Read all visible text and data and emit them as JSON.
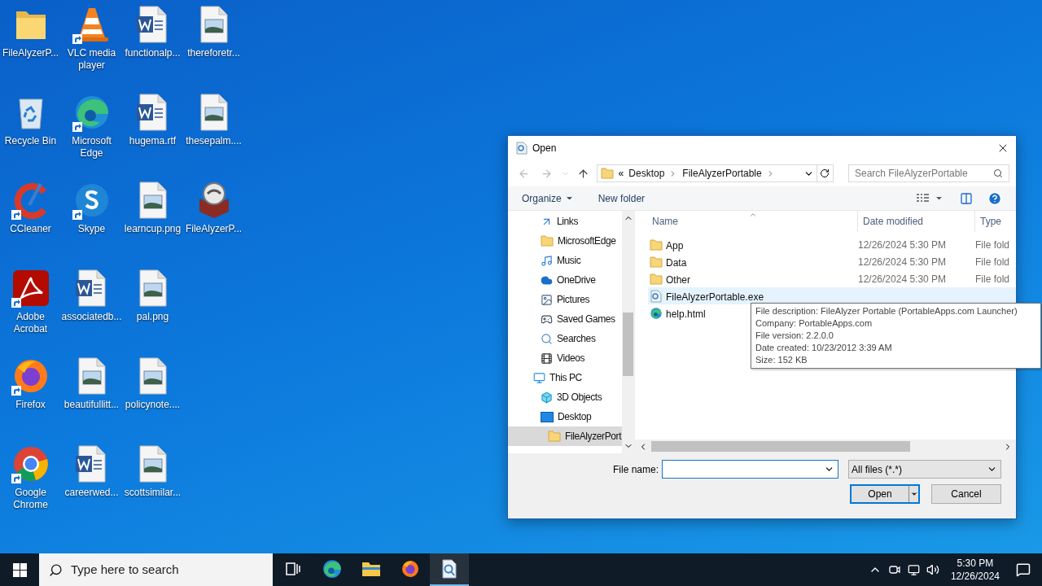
{
  "desktop_icons": [
    {
      "label": "FileAlyzerP...",
      "kind": "folder",
      "shortcut": false
    },
    {
      "label": "Recycle Bin",
      "kind": "recycle",
      "shortcut": false
    },
    {
      "label": "CCleaner",
      "kind": "ccleaner",
      "shortcut": true
    },
    {
      "label": "Adobe Acrobat",
      "kind": "acrobat",
      "shortcut": true
    },
    {
      "label": "Firefox",
      "kind": "firefox",
      "shortcut": true
    },
    {
      "label": "Google Chrome",
      "kind": "chrome",
      "shortcut": true
    },
    {
      "label": "VLC media player",
      "kind": "vlc",
      "shortcut": true
    },
    {
      "label": "Microsoft Edge",
      "kind": "edge",
      "shortcut": true
    },
    {
      "label": "Skype",
      "kind": "skype",
      "shortcut": true
    },
    {
      "label": "associatedb...",
      "kind": "word",
      "shortcut": false
    },
    {
      "label": "beautifullitt...",
      "kind": "image",
      "shortcut": false
    },
    {
      "label": "careerwed...",
      "kind": "word",
      "shortcut": false
    },
    {
      "label": "functionalp...",
      "kind": "word",
      "shortcut": false
    },
    {
      "label": "hugema.rtf",
      "kind": "word",
      "shortcut": false
    },
    {
      "label": "learncup.png",
      "kind": "image",
      "shortcut": false
    },
    {
      "label": "pal.png",
      "kind": "image",
      "shortcut": false
    },
    {
      "label": "policynote....",
      "kind": "image",
      "shortcut": false
    },
    {
      "label": "scottsimilar...",
      "kind": "image",
      "shortcut": false
    },
    {
      "label": "thereforetr...",
      "kind": "image",
      "shortcut": false
    },
    {
      "label": "thesepalm....",
      "kind": "image",
      "shortcut": false
    },
    {
      "label": "FileAlyzerP...",
      "kind": "appbox",
      "shortcut": false
    }
  ],
  "dialog": {
    "title": "Open",
    "address": {
      "overflow": "«",
      "path": [
        "Desktop",
        "FileAlyzerPortable"
      ]
    },
    "search": {
      "placeholder": "Search FileAlyzerPortable"
    },
    "toolbar": {
      "organize": "Organize",
      "new_folder": "New folder"
    },
    "tree": {
      "scrolled_items": [
        {
          "label": "Links",
          "kind": "links",
          "selected": false
        },
        {
          "label": "MicrosoftEdge",
          "kind": "folder",
          "selected": false
        },
        {
          "label": "Music",
          "kind": "music",
          "selected": false
        },
        {
          "label": "OneDrive",
          "kind": "cloud",
          "selected": false
        },
        {
          "label": "Pictures",
          "kind": "pictures",
          "selected": false
        },
        {
          "label": "Saved Games",
          "kind": "games",
          "selected": false
        },
        {
          "label": "Searches",
          "kind": "search",
          "selected": false
        },
        {
          "label": "Videos",
          "kind": "videos",
          "selected": false
        }
      ],
      "roots": [
        {
          "label": "This PC",
          "kind": "pc",
          "selected": false,
          "children": [
            {
              "label": "3D Objects",
              "kind": "cube",
              "selected": false
            },
            {
              "label": "Desktop",
              "kind": "desktop",
              "selected": false,
              "children": [
                {
                  "label": "FileAlyzerPort",
                  "kind": "folder",
                  "selected": true
                }
              ]
            }
          ]
        }
      ]
    },
    "columns": [
      "Name",
      "Date modified",
      "Type"
    ],
    "files": [
      {
        "name": "App",
        "kind": "folder",
        "date": "12/26/2024 5:30 PM",
        "type": "File fold",
        "hovered": false
      },
      {
        "name": "Data",
        "kind": "folder",
        "date": "12/26/2024 5:30 PM",
        "type": "File fold",
        "hovered": false
      },
      {
        "name": "Other",
        "kind": "folder",
        "date": "12/26/2024 5:30 PM",
        "type": "File fold",
        "hovered": false
      },
      {
        "name": "FileAlyzerPortable.exe",
        "kind": "exe",
        "hovered": true
      },
      {
        "name": "help.html",
        "kind": "edge",
        "hovered": false
      }
    ],
    "tooltip": [
      "File description: FileAlyzer Portable (PortableApps.com Launcher)",
      "Company: PortableApps.com",
      "File version: 2.2.0.0",
      "Date created: 10/23/2012 3:39 AM",
      "Size: 152 KB"
    ],
    "file_name": {
      "label": "File name:"
    },
    "filter": "All files (*.*)",
    "buttons": [
      {
        "label": "Open",
        "kind": "split"
      },
      {
        "label": "Cancel",
        "kind": "plain"
      }
    ]
  },
  "taskbar": {
    "search": {
      "placeholder": "Type here to search"
    },
    "apps": [
      {
        "kind": "taskview",
        "active": false
      },
      {
        "kind": "edge",
        "active": false
      },
      {
        "kind": "explorer",
        "active": false
      },
      {
        "kind": "firefox",
        "active": false
      },
      {
        "kind": "viewer",
        "active": true
      }
    ],
    "time": "5:30 PM",
    "date": "12/26/2024"
  }
}
